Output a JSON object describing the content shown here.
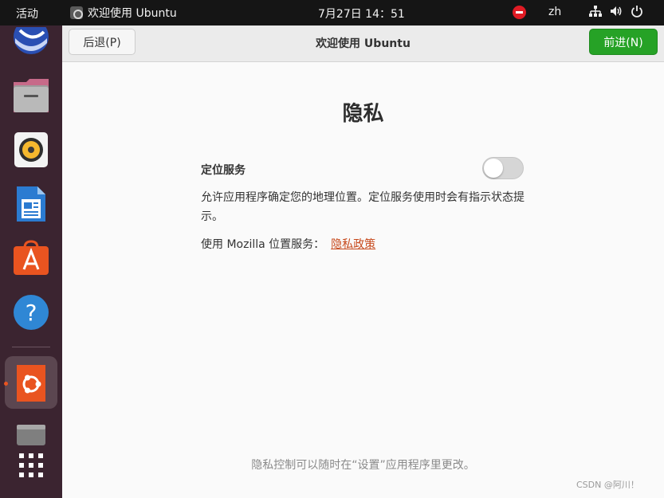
{
  "topbar": {
    "activities": "活动",
    "app_title": "欢迎使用 Ubuntu",
    "clock": "7月27日  14：51",
    "language": "zh",
    "icons": [
      "do-not-disturb-icon",
      "network-icon",
      "volume-icon",
      "power-icon"
    ]
  },
  "dock": {
    "items": [
      {
        "name": "thunderbird-icon"
      },
      {
        "name": "files-icon"
      },
      {
        "name": "rhythmbox-icon"
      },
      {
        "name": "libreoffice-writer-icon"
      },
      {
        "name": "app-center-icon"
      },
      {
        "name": "help-icon"
      },
      {
        "name": "ubuntu-welcome-icon",
        "active": true
      },
      {
        "name": "trash-icon"
      },
      {
        "name": "show-apps-icon"
      }
    ],
    "accent": "#e95420"
  },
  "window": {
    "title": "欢迎使用 Ubuntu",
    "back_label": "后退(P)",
    "next_label": "前进(N)",
    "page_title": "隐私",
    "location_label": "定位服务",
    "location_enabled": false,
    "description": "允许应用程序确定您的地理位置。定位服务使用时会有指示状态提示。",
    "mozilla_prefix": "使用 Mozilla 位置服务：",
    "privacy_link": "隐私政策",
    "footer_note": "隐私控制可以随时在“设置”应用程序里更改。"
  },
  "watermark": "CSDN @阿川！",
  "colors": {
    "next_button": "#26a226",
    "link": "#c7491c",
    "dock_bg": "#3b2430",
    "topbar_bg": "#151515"
  }
}
